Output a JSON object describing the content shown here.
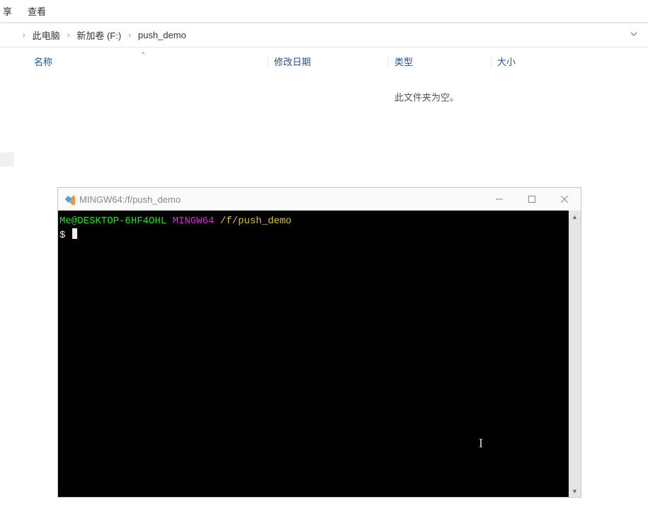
{
  "ribbon": {
    "tab_share": "享",
    "tab_view": "查看"
  },
  "breadcrumb": {
    "items": [
      "此电脑",
      "新加卷 (F:)",
      "push_demo"
    ]
  },
  "columns": {
    "name": "名称",
    "date": "修改日期",
    "type": "类型",
    "size": "大小"
  },
  "empty_text": "此文件夹为空。",
  "terminal": {
    "title": "MINGW64:/f/push_demo",
    "prompt": {
      "user_host": "Me@DESKTOP-6HF4OHL",
      "env": "MINGW64",
      "path": "/f/push_demo",
      "symbol": "$"
    }
  }
}
